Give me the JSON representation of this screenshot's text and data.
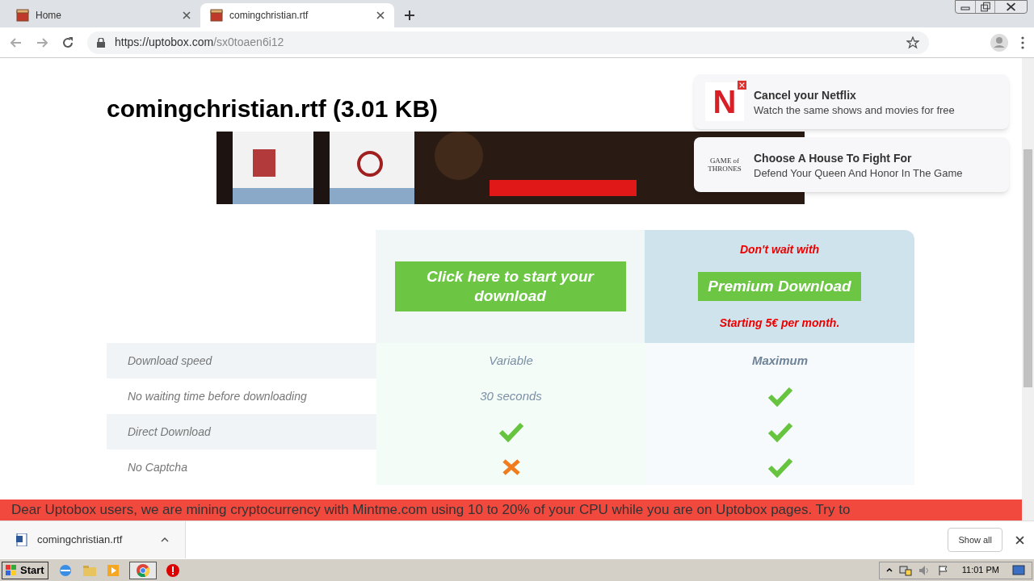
{
  "browser": {
    "tabs": [
      {
        "title": "Home",
        "selected": false
      },
      {
        "title": "comingchristian.rtf",
        "selected": true
      }
    ],
    "url_host": "https://uptobox.com",
    "url_path": "/sx0toaen6i12"
  },
  "page": {
    "title": "comingchristian.rtf (3.01 KB)",
    "notifications": [
      {
        "kind": "netflix",
        "logo": "N",
        "title": "Cancel your Netflix",
        "body": "Watch the same shows and movies for free"
      },
      {
        "kind": "got",
        "logo": "GAME of THRONES",
        "title": "Choose A House To Fight For",
        "body": "Defend Your Queen And Honor In The Game"
      }
    ],
    "free_button": "Click here to start your download",
    "premium_top": "Don't wait with",
    "premium_button": "Premium Download",
    "premium_bottom": "Starting 5€ per month.",
    "rows": [
      {
        "label": "Download speed",
        "free": {
          "kind": "text",
          "text": "Variable"
        },
        "premium": {
          "kind": "bold",
          "text": "Maximum"
        }
      },
      {
        "label": "No waiting time before downloading",
        "free": {
          "kind": "text",
          "text": "30 seconds"
        },
        "premium": {
          "kind": "check"
        }
      },
      {
        "label": "Direct Download",
        "free": {
          "kind": "check"
        },
        "premium": {
          "kind": "check"
        }
      },
      {
        "label": "No Captcha",
        "free": {
          "kind": "cross"
        },
        "premium": {
          "kind": "check"
        }
      }
    ],
    "notice": "Dear Uptobox users, we are mining cryptocurrency with Mintme.com using 10 to 20% of your CPU while you are on Uptobox pages. Try to"
  },
  "download_shelf": {
    "file": "comingchristian.rtf",
    "show_all": "Show all"
  },
  "taskbar": {
    "start": "Start",
    "clock": "11:01 PM"
  }
}
